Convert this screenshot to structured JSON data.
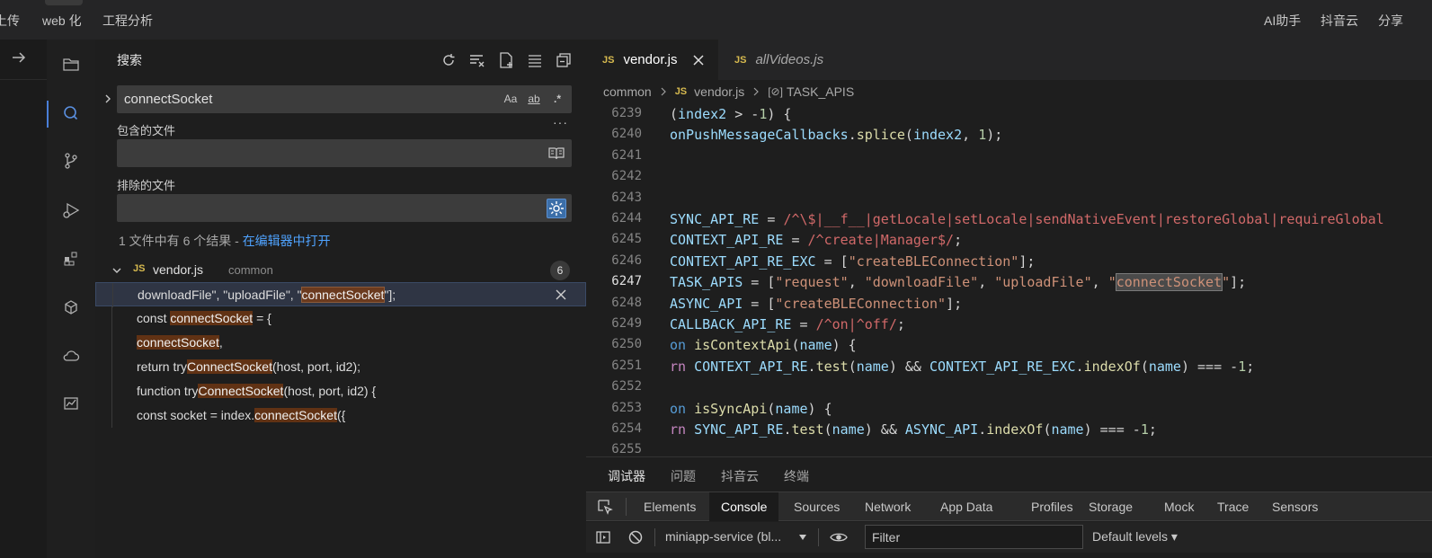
{
  "menubar": {
    "items_left": [
      "上传",
      "web 化",
      "工程分析"
    ],
    "items_right": [
      "AI助手",
      "抖音云",
      "分享"
    ]
  },
  "sidebar": {
    "title": "搜索",
    "search": {
      "value": "connectSocket",
      "opt_case": "Aa",
      "opt_word": "ab",
      "opt_regex": ".*"
    },
    "include_label": "包含的文件",
    "exclude_label": "排除的文件",
    "result_summary": "1 文件中有 6 个结果 - ",
    "open_in_editor": "在编辑器中打开",
    "file": {
      "name": "vendor.js",
      "dir": "common",
      "count": "6",
      "badge": "JS"
    },
    "matches": [
      {
        "before": "downloadFile\", \"uploadFile\", \"",
        "match": "connectSocket",
        "after": "\"];"
      },
      {
        "before": "const ",
        "match": "connectSocket",
        "after": " = {"
      },
      {
        "before": "",
        "match": "connectSocket",
        "after": ","
      },
      {
        "before": "return try",
        "match": "ConnectSocket",
        "after": "(host, port, id2);"
      },
      {
        "before": "function try",
        "match": "ConnectSocket",
        "after": "(host, port, id2) {"
      },
      {
        "before": "const socket = index.",
        "match": "connectSocket",
        "after": "({"
      }
    ]
  },
  "editor": {
    "tabs": [
      {
        "badge": "JS",
        "label": "vendor.js"
      },
      {
        "badge": "JS",
        "label": "allVideos.js"
      }
    ],
    "breadcrumb": {
      "folder": "common",
      "file": "vendor.js",
      "symbol": "TASK_APIS"
    },
    "current_line": "6247",
    "lines": [
      {
        "n": "6239",
        "parts": [
          [
            "op",
            "("
          ],
          [
            "def",
            "index2"
          ],
          [
            "op",
            " > -"
          ],
          [
            "num",
            "1"
          ],
          [
            "op",
            ") {"
          ]
        ]
      },
      {
        "n": "6240",
        "parts": [
          [
            "def",
            "onPushMessageCallbacks"
          ],
          [
            "op",
            "."
          ],
          [
            "fn",
            "splice"
          ],
          [
            "op",
            "("
          ],
          [
            "def",
            "index2"
          ],
          [
            "op",
            ", "
          ],
          [
            "num",
            "1"
          ],
          [
            "op",
            ");"
          ]
        ]
      },
      {
        "n": "6241",
        "parts": []
      },
      {
        "n": "6242",
        "parts": []
      },
      {
        "n": "6243",
        "parts": []
      },
      {
        "n": "6244",
        "parts": [
          [
            "def",
            "SYNC_API_RE"
          ],
          [
            "op",
            " = "
          ],
          [
            "re",
            "/^\\$|__f__|getLocale|setLocale|sendNativeEvent|restoreGlobal|requireGlobal"
          ]
        ]
      },
      {
        "n": "6245",
        "parts": [
          [
            "def",
            "CONTEXT_API_RE"
          ],
          [
            "op",
            " = "
          ],
          [
            "re",
            "/^create|Manager$/"
          ],
          [
            "op",
            ";"
          ]
        ]
      },
      {
        "n": "6246",
        "parts": [
          [
            "def",
            "CONTEXT_API_RE_EXC"
          ],
          [
            "op",
            " = ["
          ],
          [
            "str",
            "\"createBLEConnection\""
          ],
          [
            "op",
            "];"
          ]
        ]
      },
      {
        "n": "6247",
        "parts": [
          [
            "def",
            "TASK_APIS"
          ],
          [
            "op",
            " = ["
          ],
          [
            "str",
            "\"request\""
          ],
          [
            "op",
            ", "
          ],
          [
            "str",
            "\"downloadFile\""
          ],
          [
            "op",
            ", "
          ],
          [
            "str",
            "\"uploadFile\""
          ],
          [
            "op",
            ", "
          ],
          [
            "str",
            "\""
          ],
          [
            "match",
            "connectSocket"
          ],
          [
            "str",
            "\""
          ],
          [
            "op",
            "];"
          ]
        ]
      },
      {
        "n": "6248",
        "parts": [
          [
            "def",
            "ASYNC_API"
          ],
          [
            "op",
            " = ["
          ],
          [
            "str",
            "\"createBLEConnection\""
          ],
          [
            "op",
            "];"
          ]
        ]
      },
      {
        "n": "6249",
        "parts": [
          [
            "def",
            "CALLBACK_API_RE"
          ],
          [
            "op",
            " = "
          ],
          [
            "re",
            "/^on|^off/"
          ],
          [
            "op",
            ";"
          ]
        ]
      },
      {
        "n": "6250",
        "parts": [
          [
            "bl",
            "on "
          ],
          [
            "fn",
            "isContextApi"
          ],
          [
            "op",
            "("
          ],
          [
            "def",
            "name"
          ],
          [
            "op",
            ") {"
          ]
        ]
      },
      {
        "n": "6251",
        "parts": [
          [
            "kw",
            "rn "
          ],
          [
            "def",
            "CONTEXT_API_RE"
          ],
          [
            "op",
            "."
          ],
          [
            "fn",
            "test"
          ],
          [
            "op",
            "("
          ],
          [
            "def",
            "name"
          ],
          [
            "op",
            ") && "
          ],
          [
            "def",
            "CONTEXT_API_RE_EXC"
          ],
          [
            "op",
            "."
          ],
          [
            "fn",
            "indexOf"
          ],
          [
            "op",
            "("
          ],
          [
            "def",
            "name"
          ],
          [
            "op",
            ") === -"
          ],
          [
            "num",
            "1"
          ],
          [
            "op",
            ";"
          ]
        ]
      },
      {
        "n": "6252",
        "parts": []
      },
      {
        "n": "6253",
        "parts": [
          [
            "bl",
            "on "
          ],
          [
            "fn",
            "isSyncApi"
          ],
          [
            "op",
            "("
          ],
          [
            "def",
            "name"
          ],
          [
            "op",
            ") {"
          ]
        ]
      },
      {
        "n": "6254",
        "parts": [
          [
            "kw",
            "rn "
          ],
          [
            "def",
            "SYNC_API_RE"
          ],
          [
            "op",
            "."
          ],
          [
            "fn",
            "test"
          ],
          [
            "op",
            "("
          ],
          [
            "def",
            "name"
          ],
          [
            "op",
            ") && "
          ],
          [
            "def",
            "ASYNC_API"
          ],
          [
            "op",
            "."
          ],
          [
            "fn",
            "indexOf"
          ],
          [
            "op",
            "("
          ],
          [
            "def",
            "name"
          ],
          [
            "op",
            ") === -"
          ],
          [
            "num",
            "1"
          ],
          [
            "op",
            ";"
          ]
        ]
      },
      {
        "n": "6255",
        "parts": []
      }
    ]
  },
  "panel": {
    "tabs": [
      "调试器",
      "问题",
      "抖音云",
      "终端"
    ],
    "devtools_tabs": [
      "Elements",
      "Console",
      "Sources",
      "Network",
      "App Data",
      "Profiles",
      "Storage",
      "Mock",
      "Trace",
      "Sensors"
    ],
    "active_devtools_tab": "Console",
    "context": "miniapp-service (bl...",
    "filter_placeholder": "Filter",
    "levels": "Default levels"
  },
  "colors": {
    "background": "#1e1e1e",
    "accent": "#4a7fd8",
    "match_highlight": "#613214",
    "js_badge": "#d7ba4f",
    "link": "#4fa3ff"
  },
  "icons": [
    "arrow-right-icon",
    "folder-icon",
    "search-icon",
    "branch-icon",
    "run-debug-icon",
    "extensions-icon",
    "package-icon",
    "cloud-icon",
    "chart-icon",
    "refresh-icon",
    "clear-results-icon",
    "new-search-editor-icon",
    "collapse-all-icon",
    "view-as-tree-icon",
    "book-icon",
    "settings-gear-icon",
    "close-icon",
    "inspect-icon",
    "sidebar-toggle-icon",
    "block-icon",
    "eye-icon"
  ]
}
